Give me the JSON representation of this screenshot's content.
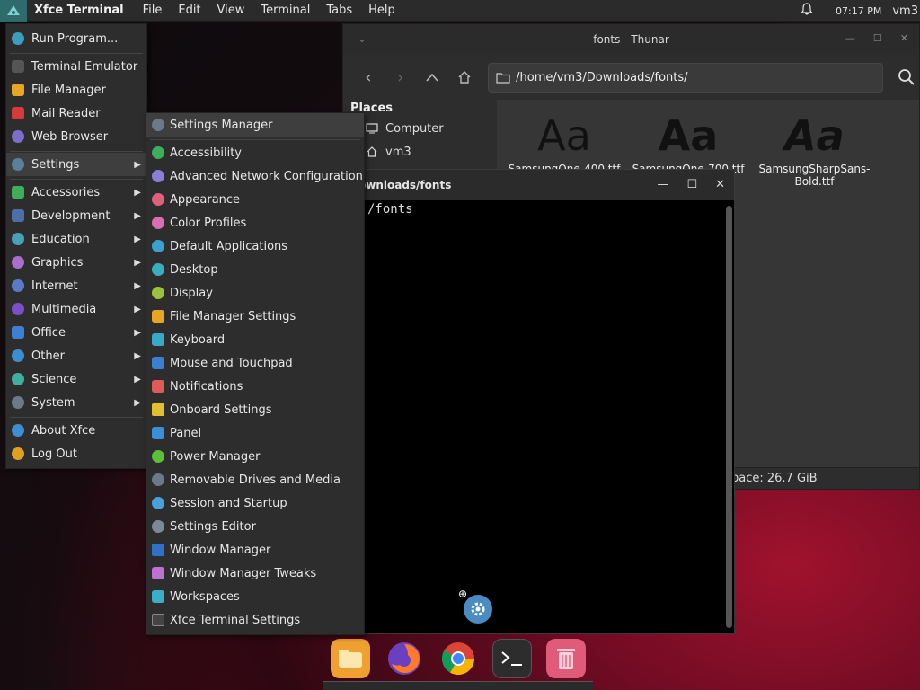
{
  "top_panel": {
    "app_title": "Xfce Terminal",
    "menu": [
      "File",
      "Edit",
      "View",
      "Terminal",
      "Tabs",
      "Help"
    ],
    "clock": "07:17 PM",
    "user": "vm3"
  },
  "thunar": {
    "title": "fonts - Thunar",
    "path": "/home/vm3/Downloads/fonts/",
    "sidebar_heading": "Places",
    "places": [
      "Computer",
      "vm3"
    ],
    "files": [
      {
        "name": "SamsungOne-400.ttf",
        "preview": "Aa"
      },
      {
        "name": "SamsungOne-700.ttf",
        "preview": "Aa"
      },
      {
        "name": "SamsungSharpSans-Bold.ttf",
        "preview": "Aa"
      }
    ],
    "status": "pace: 26.7 GiB"
  },
  "terminal": {
    "title": "ownloads/fonts",
    "content": "/fonts"
  },
  "main_menu": {
    "items": [
      {
        "label": "Run Program...",
        "color": "#3a9fbf"
      },
      {
        "label": "Terminal Emulator",
        "color": "#555555"
      },
      {
        "label": "File Manager",
        "color": "#e9a426"
      },
      {
        "label": "Mail Reader",
        "color": "#d63a3a"
      },
      {
        "label": "Web Browser",
        "color": "#7b6fc9"
      },
      {
        "label": "Settings",
        "color": "#5a7f9a"
      },
      {
        "label": "Accessories",
        "color": "#3fae5a"
      },
      {
        "label": "Development",
        "color": "#4d6fa8"
      },
      {
        "label": "Education",
        "color": "#4aa0b8"
      },
      {
        "label": "Graphics",
        "color": "#a96fcf"
      },
      {
        "label": "Internet",
        "color": "#5b79c9"
      },
      {
        "label": "Multimedia",
        "color": "#7a4fc7"
      },
      {
        "label": "Office",
        "color": "#3d7fd0"
      },
      {
        "label": "Other",
        "color": "#3c8fcf"
      },
      {
        "label": "Science",
        "color": "#3fb0a0"
      },
      {
        "label": "System",
        "color": "#6a7a88"
      },
      {
        "label": "About Xfce",
        "color": "#3c8fd0"
      },
      {
        "label": "Log Out",
        "color": "#e0a020"
      }
    ]
  },
  "settings_menu": {
    "items": [
      {
        "label": "Settings Manager",
        "color": "#6a7a88"
      },
      {
        "label": "Accessibility",
        "color": "#3fae5a"
      },
      {
        "label": "Advanced Network Configuration",
        "color": "#8a7fd8"
      },
      {
        "label": "Appearance",
        "color": "#e0607a"
      },
      {
        "label": "Color Profiles",
        "color": "#d76fb0"
      },
      {
        "label": "Default Applications",
        "color": "#3aa0d0"
      },
      {
        "label": "Desktop",
        "color": "#3aaec0"
      },
      {
        "label": "Display",
        "color": "#9ac23a"
      },
      {
        "label": "File Manager Settings",
        "color": "#e9a426"
      },
      {
        "label": "Keyboard",
        "color": "#3aa8c8"
      },
      {
        "label": "Mouse and Touchpad",
        "color": "#3b7fd0"
      },
      {
        "label": "Notifications",
        "color": "#e05a5a"
      },
      {
        "label": "Onboard Settings",
        "color": "#e0c030"
      },
      {
        "label": "Panel",
        "color": "#3a8fd8"
      },
      {
        "label": "Power Manager",
        "color": "#5cbf3a"
      },
      {
        "label": "Removable Drives and Media",
        "color": "#6a7a88"
      },
      {
        "label": "Session and Startup",
        "color": "#4aa0d8"
      },
      {
        "label": "Settings Editor",
        "color": "#7a8a98"
      },
      {
        "label": "Window Manager",
        "color": "#3070c8"
      },
      {
        "label": "Window Manager Tweaks",
        "color": "#c070d0"
      },
      {
        "label": "Workspaces",
        "color": "#3ab0c8"
      },
      {
        "label": "Xfce Terminal Settings",
        "color": "#444444"
      }
    ]
  },
  "dock": {
    "items": [
      {
        "name": "file-manager",
        "color": "#f0a030"
      },
      {
        "name": "firefox",
        "color": "#6a3fc0"
      },
      {
        "name": "chrome",
        "color": "#4285f4"
      },
      {
        "name": "terminal",
        "color": "#2d2d2d"
      },
      {
        "name": "trash",
        "color": "#e05a7a"
      }
    ]
  }
}
